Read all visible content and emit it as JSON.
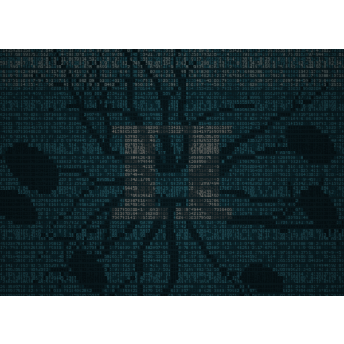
{
  "image": {
    "subject": "pi-symbol-ascii-art",
    "glyph": "π",
    "digits": "31415926535897932384626433832795028841971693993751058209749445923078164062862089986280348253421170679",
    "palette": {
      "background": "#0b1c21",
      "digit_dark": "#0f3a44",
      "digit_teal": "#2f6f7c",
      "digit_light": "#8a9a98",
      "glyph_fill": "#9a8f86",
      "crack": "#03090b",
      "page": "#ffffff"
    }
  }
}
